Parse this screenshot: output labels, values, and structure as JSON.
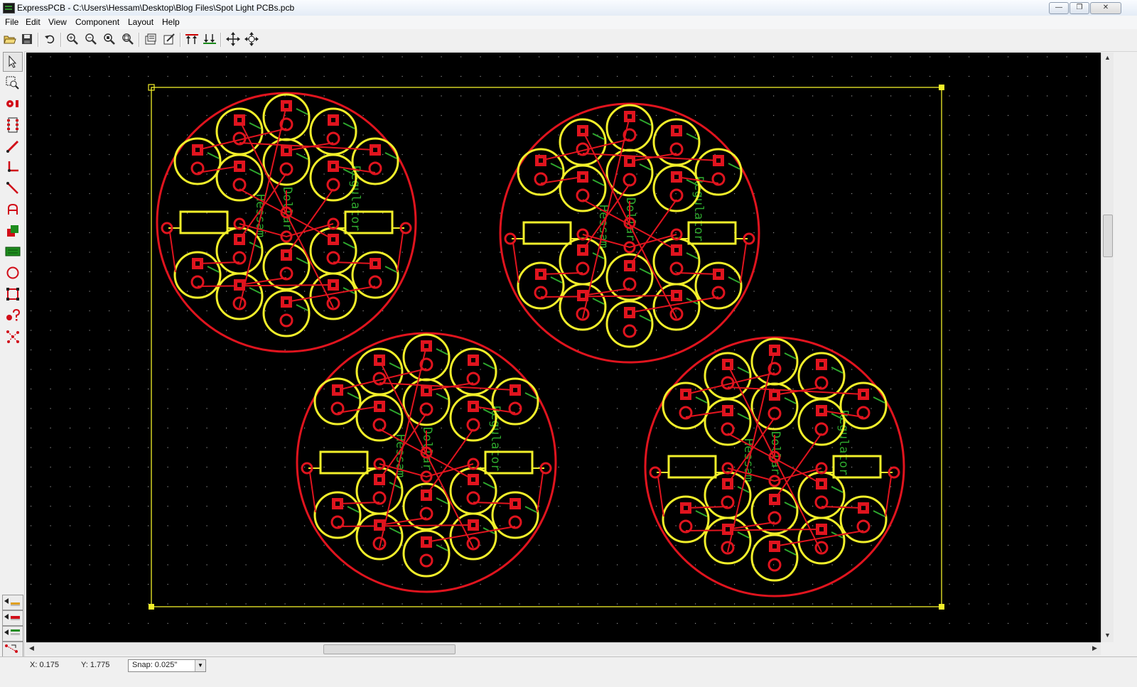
{
  "window": {
    "title": "ExpressPCB - C:\\Users\\Hessam\\Desktop\\Blog Files\\Spot Light PCBs.pcb",
    "minimize_symbol": "—",
    "restore_symbol": "❐",
    "close_symbol": "✕"
  },
  "menu": [
    "File",
    "Edit",
    "View",
    "Component",
    "Layout",
    "Help"
  ],
  "toolbar": {
    "buttons": [
      "open-folder-icon",
      "save-icon",
      "undo-icon",
      "zoom-in-icon",
      "zoom-out-icon",
      "zoom-window-icon",
      "zoom-fit-icon",
      "properties-icon",
      "edit-icon",
      "top-layer-icon",
      "bottom-layer-icon",
      "move-icon",
      "rotate-icon"
    ]
  },
  "tools": [
    "pointer-icon",
    "zoom-select-icon",
    "place-pad-icon",
    "place-component-icon",
    "place-trace-icon",
    "place-corner-icon",
    "place-line-icon",
    "place-text-icon",
    "filled-plane-icon",
    "ground-plane-icon",
    "circle-icon",
    "rectangle-icon",
    "component-query-icon",
    "netlist-icon"
  ],
  "layers": [
    "top-copper-layer-icon",
    "bottom-copper-layer-icon",
    "silkscreen-layer-icon",
    "netlist-layer-icon"
  ],
  "status": {
    "x": "X: 0.175",
    "y": "Y: 1.775",
    "snap": "Snap:  0.025\""
  },
  "pcb": {
    "silk_text_a": "Regulator",
    "silk_text_b": "Hessam",
    "silk_text_c": "Dollar"
  },
  "colors": {
    "canvas": "#000000",
    "copper": "#e0141e",
    "silkscreen": "#f2ef2a",
    "board_outline": "#f2ef2a",
    "silk_green": "#2ea82e"
  }
}
